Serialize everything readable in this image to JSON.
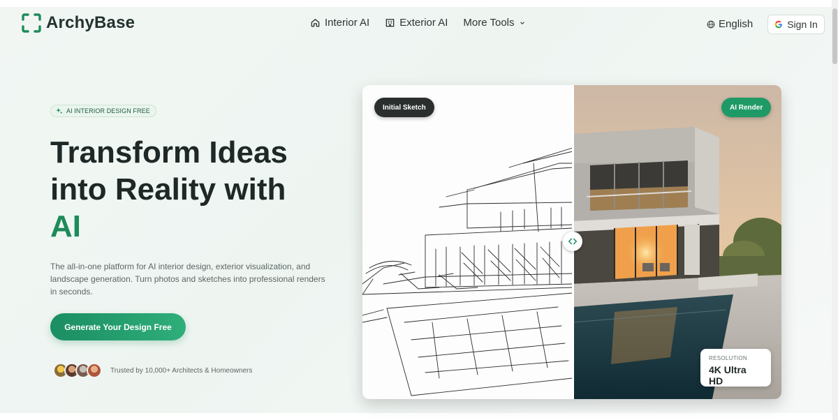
{
  "header": {
    "logo_text": "ArchyBase",
    "logo_icon": "bracket-frame-icon",
    "nav": [
      {
        "label": "Interior AI",
        "icon": "home-icon"
      },
      {
        "label": "Exterior AI",
        "icon": "building-icon"
      },
      {
        "label": "More Tools",
        "icon": "chevron-down-icon"
      }
    ],
    "language": "English",
    "sign_in": "Sign In"
  },
  "hero": {
    "badge": "AI INTERIOR DESIGN FREE",
    "headline_line1": "Transform Ideas",
    "headline_line2": "into Reality with",
    "headline_accent": "AI",
    "description": "The all-in-one platform for AI interior design, exterior visualization, and landscape generation. Turn photos and sketches into professional renders in seconds.",
    "cta": "Generate Your Design Free",
    "trust_text": "Trusted by 10,000+ Architects & Homeowners"
  },
  "compare": {
    "left_tag": "Initial Sketch",
    "right_tag": "AI Render",
    "resolution_label": "RESOLUTION",
    "resolution_value": "4K Ultra HD",
    "slider_position": 0.5
  },
  "colors": {
    "accent": "#1d8a5a",
    "cta_start": "#1b8e62",
    "cta_end": "#2fae7a",
    "dark_tag": "#2a2f2e"
  }
}
